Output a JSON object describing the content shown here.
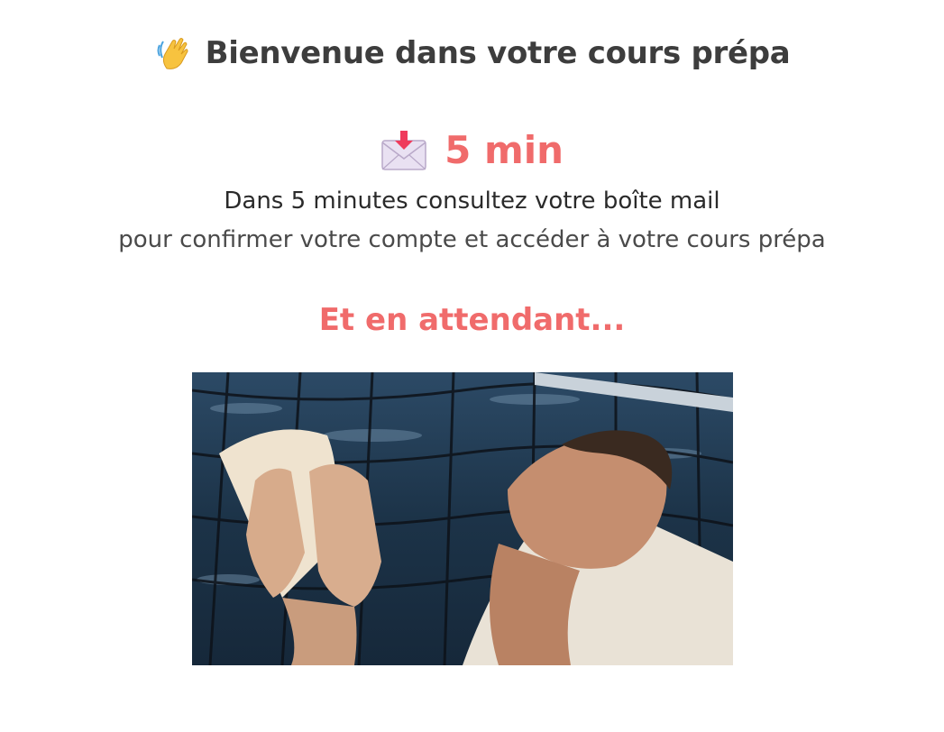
{
  "header": {
    "wave_icon": "waving-hand-icon",
    "title": "Bienvenue dans votre cours prépa"
  },
  "notice": {
    "envelope_icon": "incoming-envelope-icon",
    "time": "5 min",
    "line1": "Dans 5 minutes consultez votre boîte mail",
    "line2": "pour confirmer votre compte et accéder à votre cours prépa"
  },
  "waiting": {
    "heading": "Et en attendant..."
  },
  "media": {
    "kind": "animated-gif",
    "subject": "man-reading-letter-on-boat-net"
  },
  "colors": {
    "accent": "#f06b6b",
    "title_text": "#3d3d3d",
    "body_text": "#2a2a2a"
  }
}
